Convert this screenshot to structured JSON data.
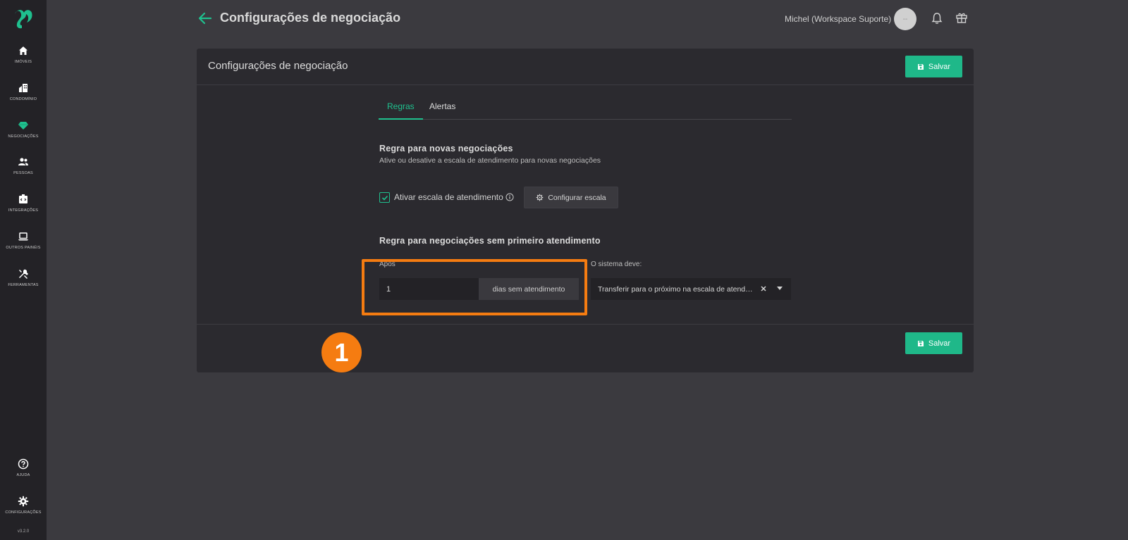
{
  "sidebar": {
    "items": [
      {
        "label": "Imóveis",
        "icon": "home-icon"
      },
      {
        "label": "Condomínio",
        "icon": "building-icon"
      },
      {
        "label": "Negociações",
        "icon": "diamond-icon"
      },
      {
        "label": "Pessoas",
        "icon": "people-icon"
      },
      {
        "label": "Integrações",
        "icon": "plugin-icon"
      },
      {
        "label": "Outros Painéis",
        "icon": "laptop-icon"
      },
      {
        "label": "Ferramentas",
        "icon": "tools-icon"
      }
    ],
    "bottom": [
      {
        "label": "Ajuda",
        "icon": "help-icon"
      },
      {
        "label": "Configurações",
        "icon": "gear-icon"
      }
    ],
    "version": "v3.2.0"
  },
  "header": {
    "title": "Configurações de negociação",
    "user": "Michel (Workspace Suporte)",
    "avatar_initials": "--"
  },
  "card": {
    "title": "Configurações de negociação",
    "save_label": "Salvar",
    "tabs": [
      {
        "label": "Regras",
        "active": true
      },
      {
        "label": "Alertas",
        "active": false
      }
    ],
    "rule_new": {
      "title": "Regra para novas negociações",
      "subtitle": "Ative ou desative a escala de atendimento para novas negociações",
      "checkbox_label": "Ativar escala de atendimento",
      "checked": true,
      "config_button": "Configurar escala"
    },
    "rule_first": {
      "title": "Regra para negociações sem primeiro atendimento",
      "after_label": "Após",
      "after_value": "1",
      "after_suffix": "dias sem atendimento",
      "system_label": "O sistema deve:",
      "system_value": "Transferir para o próximo na escala de atendimento"
    }
  },
  "annotation": {
    "step": "1"
  },
  "colors": {
    "accent": "#1fc08e",
    "button": "#1fb889",
    "highlight": "#f57c11",
    "sidebar": "#232226",
    "card": "#2b2a2f"
  }
}
